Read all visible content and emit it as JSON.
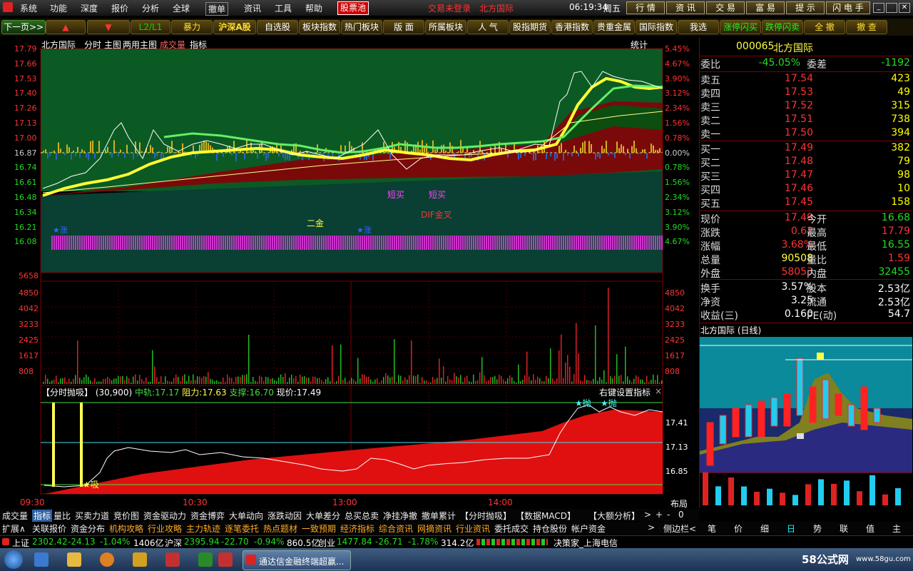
{
  "menu": {
    "items": [
      "系统",
      "功能",
      "深度",
      "报价",
      "分析",
      "全球",
      "撤单",
      "资讯",
      "工具",
      "帮助"
    ],
    "stock_pool": "股票池",
    "trade_status": "交易未登录",
    "broker": "北方国际",
    "time": "06:19:34",
    "weekday": "周五",
    "right_buttons": [
      "行 情",
      "资 讯",
      "交 易",
      "富 易",
      "提 示",
      "闪 电 手"
    ]
  },
  "toolbar": {
    "items": [
      "下一页>>",
      "▲",
      "▼",
      "L2/L1",
      "暴力",
      "沪深A股",
      "自选股",
      "板块指数",
      "热门板块",
      "版 面",
      "所属板块",
      "人 气",
      "股指期货",
      "香港指数",
      "贵重金属",
      "国际指数",
      "我选",
      "涨停闪买",
      "跌停闪卖",
      "全 撤",
      "撤 查"
    ]
  },
  "chart_header": {
    "stock": "北方国际",
    "tabs": [
      "分时",
      "主图",
      "两用主图",
      "成交量",
      "指标"
    ],
    "stat": "统计"
  },
  "price_axis": [
    "17.79",
    "17.66",
    "17.53",
    "17.40",
    "17.26",
    "17.13",
    "17.00",
    "16.87",
    "16.74",
    "16.61",
    "16.48",
    "16.34",
    "16.21",
    "16.08"
  ],
  "pct_axis": [
    "5.45%",
    "4.67%",
    "3.90%",
    "3.12%",
    "2.34%",
    "1.56%",
    "0.78%",
    "0.00%",
    "0.78%",
    "1.56%",
    "2.34%",
    "3.12%",
    "3.90%",
    "4.67%"
  ],
  "vol_axis": [
    "5658",
    "4850",
    "4042",
    "3233",
    "2425",
    "1617",
    "808"
  ],
  "annotations": {
    "short_buy_1": "短买",
    "short_buy_2": "短买",
    "second_gold": "二金",
    "dif_gold": "DIF金叉",
    "star1": "★涨",
    "star2": "★涨"
  },
  "indicator": {
    "title": "【分时抛吸】",
    "params": "(30,900)",
    "mid_label": "中轨:",
    "mid": "17.17",
    "res_label": "阻力:",
    "res": "17.63",
    "sup_label": "支撑:",
    "sup": "16.70",
    "cur_label": "现价:",
    "cur": "17.49",
    "right_text": "右键设置指标",
    "axis": [
      "17.41",
      "17.13",
      "16.85"
    ],
    "marker_xi": "吸",
    "marker_pao1": "抛",
    "marker_pao2": "抛"
  },
  "time_axis": [
    "09:30",
    "10:30",
    "13:00",
    "14:00"
  ],
  "layout_label": "布局",
  "quote": {
    "code": "000065",
    "name": "北方国际",
    "weibi_label": "委比",
    "weibi": "-45.05%",
    "weicha_label": "委差",
    "weicha": "-1192",
    "sells": [
      {
        "label": "卖五",
        "price": "17.54",
        "vol": "423"
      },
      {
        "label": "卖四",
        "price": "17.53",
        "vol": "49"
      },
      {
        "label": "卖三",
        "price": "17.52",
        "vol": "315"
      },
      {
        "label": "卖二",
        "price": "17.51",
        "vol": "738"
      },
      {
        "label": "卖一",
        "price": "17.50",
        "vol": "394"
      }
    ],
    "buys": [
      {
        "label": "买一",
        "price": "17.49",
        "vol": "382"
      },
      {
        "label": "买二",
        "price": "17.48",
        "vol": "79"
      },
      {
        "label": "买三",
        "price": "17.47",
        "vol": "98"
      },
      {
        "label": "买四",
        "price": "17.46",
        "vol": "10"
      },
      {
        "label": "买五",
        "price": "17.45",
        "vol": "158"
      }
    ],
    "stats": [
      {
        "l1": "现价",
        "v1": "17.49",
        "l2": "今开",
        "v2": "16.68",
        "c1": "r",
        "c2": "g"
      },
      {
        "l1": "涨跌",
        "v1": "0.62",
        "l2": "最高",
        "v2": "17.79",
        "c1": "r",
        "c2": "r"
      },
      {
        "l1": "涨幅",
        "v1": "3.68%",
        "l2": "最低",
        "v2": "16.55",
        "c1": "r",
        "c2": "g"
      },
      {
        "l1": "总量",
        "v1": "90508",
        "l2": "量比",
        "v2": "1.59",
        "c1": "y",
        "c2": "r"
      },
      {
        "l1": "外盘",
        "v1": "58053",
        "l2": "内盘",
        "v2": "32455",
        "c1": "r",
        "c2": "g"
      },
      {
        "l1": "换手",
        "v1": "3.57%",
        "l2": "股本",
        "v2": "2.53亿",
        "c1": "w",
        "c2": "w"
      },
      {
        "l1": "净资",
        "v1": "3.25",
        "l2": "流通",
        "v2": "2.53亿",
        "c1": "w",
        "c2": "w"
      },
      {
        "l1": "收益(三)",
        "v1": "0.160",
        "l2": "PE(动)",
        "v2": "54.7",
        "c1": "w",
        "c2": "w"
      }
    ],
    "daily_title": "北方国际 (日线)"
  },
  "bottom_tabs1": [
    "成交量",
    "指标",
    "量比",
    "买卖力道",
    "竞价图",
    "资金驱动力",
    "资金博弈",
    "大单动向",
    "涨跌动因",
    "大单差分",
    "总买总卖",
    "净挂净撤",
    "撤单累计",
    "【分时抛吸】",
    "【数据MACD】",
    "【大额分析】",
    ">",
    "+",
    "-",
    "0"
  ],
  "bottom_tabs2": [
    "扩展∧",
    "关联报价",
    "资金分布",
    "机构攻略",
    "行业攻略",
    "主力轨迹",
    "逐笔委托",
    "热点题材",
    "一致预期",
    "经济指标",
    "综合资讯",
    "网摘资讯",
    "行业资讯",
    "委托成交",
    "持仓股份",
    "帐户资金",
    ">",
    "侧边栏<"
  ],
  "right_tabs": [
    "笔",
    "价",
    "细",
    "日",
    "势",
    "联",
    "值",
    "主"
  ],
  "status": {
    "sh_name": "上证",
    "sh_val": "2302.42",
    "sh_chg": "-24.13",
    "sh_pct": "-1.04%",
    "sh_amt": "1406亿",
    "hs_name": "沪深",
    "hs_val": "2395.94",
    "hs_chg": "-22.70",
    "hs_pct": "-0.94%",
    "hs_amt": "860.5亿",
    "cy_name": "创业",
    "cy_val": "1477.84",
    "cy_chg": "-26.71",
    "cy_pct": "-1.78%",
    "cy_amt": "314.2亿",
    "server": "决策家_上海电信"
  },
  "taskbar": {
    "window_title": "通达信金融终端超赢...",
    "watermark": "58公式网",
    "watermark_url": "www.58gu.com"
  }
}
